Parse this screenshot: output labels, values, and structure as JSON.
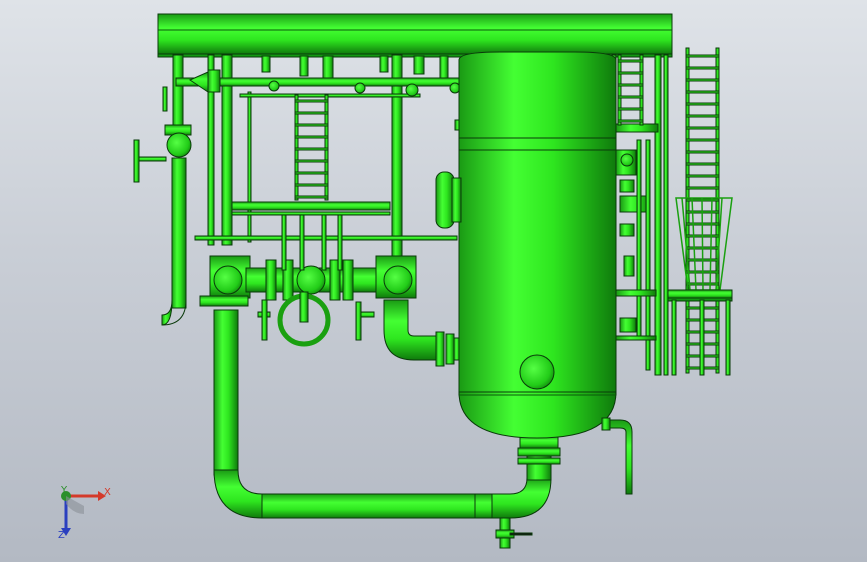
{
  "viewport": {
    "background_top": "#dfe3e8",
    "background_bottom": "#b3b9c3"
  },
  "model": {
    "highlight_color": "#33ee22",
    "shadow_color": "#118811",
    "outline_color": "#0a3a0a",
    "components": [
      "top-frame",
      "vertical-vessel",
      "header-pipes",
      "u-bend-pipe",
      "ladders",
      "platform",
      "valves",
      "nozzles"
    ]
  },
  "triad": {
    "x_label": "X",
    "y_label": "Y",
    "z_label": "Z",
    "x_color": "#d43a2a",
    "y_color": "#2a8f2a",
    "z_color": "#2a3fbf"
  }
}
